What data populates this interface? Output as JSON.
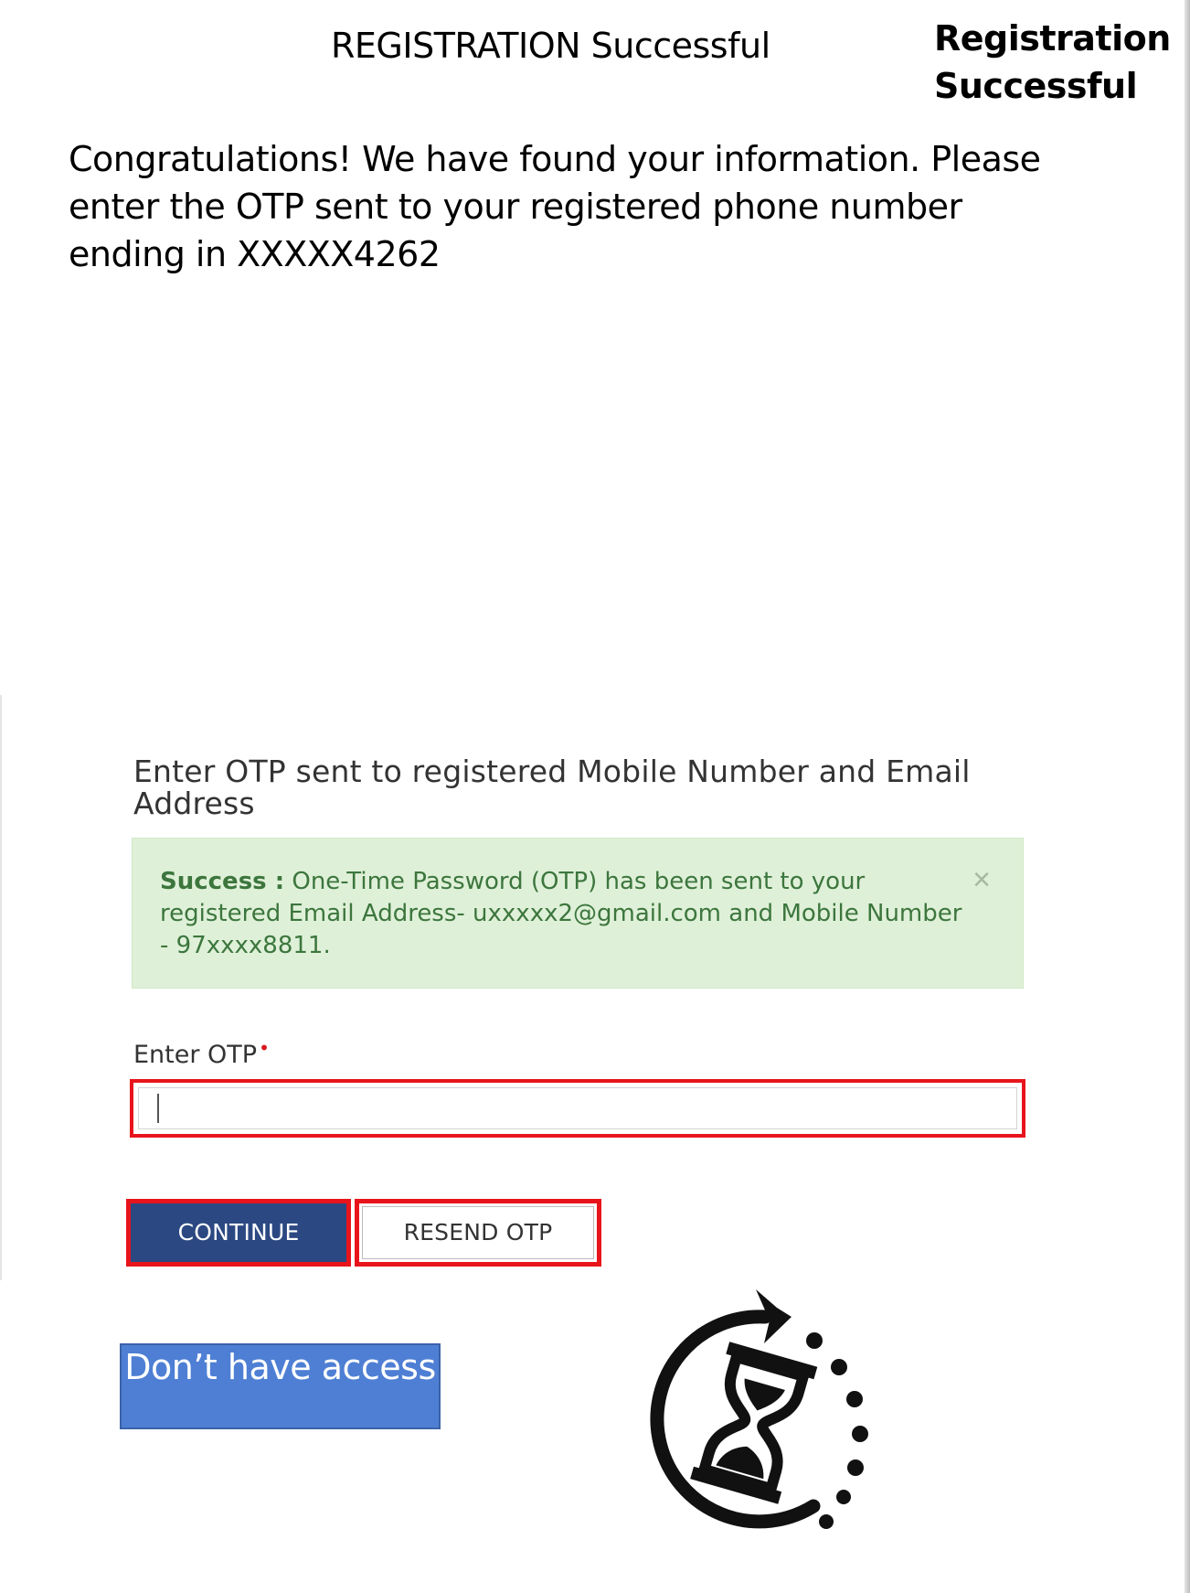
{
  "header": {
    "title": "REGISTRATION Successful",
    "side_title": "Registration Successful"
  },
  "message": "Congratulations! We have found your information. Please enter the OTP sent to your registered phone number ending in XXXXX4262",
  "otp_form": {
    "heading": "Enter OTP sent to registered Mobile Number and Email Address",
    "alert": {
      "label": "Success :",
      "text": "One-Time Password (OTP) has been sent to your registered Email Address- uxxxxx2@gmail.com and Mobile Number - 97xxxx8811.",
      "close_symbol": "×",
      "color": "#dff0d8"
    },
    "field_label": "Enter OTP",
    "required_marker": "•",
    "input_value": "",
    "continue_label": "CONTINUE",
    "resend_label": "RESEND OTP"
  },
  "access_button": {
    "label": "Don’t have access",
    "color": "#4e7fd4"
  },
  "icons": {
    "timer": "hourglass-refresh-icon"
  },
  "colors": {
    "continue_bg": "#2b4882",
    "highlight_border": "#e8141c"
  }
}
